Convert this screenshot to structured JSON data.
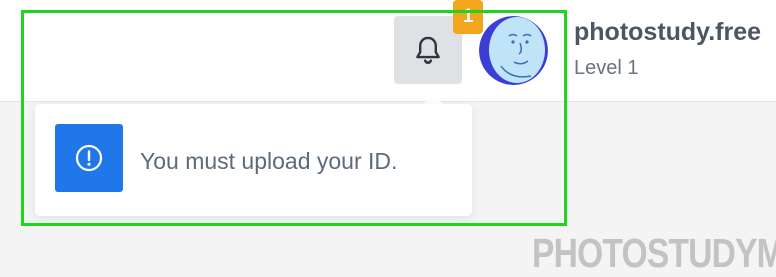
{
  "header": {
    "notification_icon": "bell-icon",
    "notification_count": "1",
    "user": {
      "name": "photostudy.free",
      "level": "Level 1",
      "avatar": "cartoon-face-avatar"
    }
  },
  "notifications": [
    {
      "icon": "exclamation-circle-icon",
      "text": "You must upload your ID."
    }
  ],
  "watermark": "PHOTOSTUDYME",
  "colors": {
    "badge": "#f3a51d",
    "notification_icon_bg": "#1f77ea",
    "highlight": "#1fd41f",
    "bell_button_bg": "#dfe1e4"
  }
}
